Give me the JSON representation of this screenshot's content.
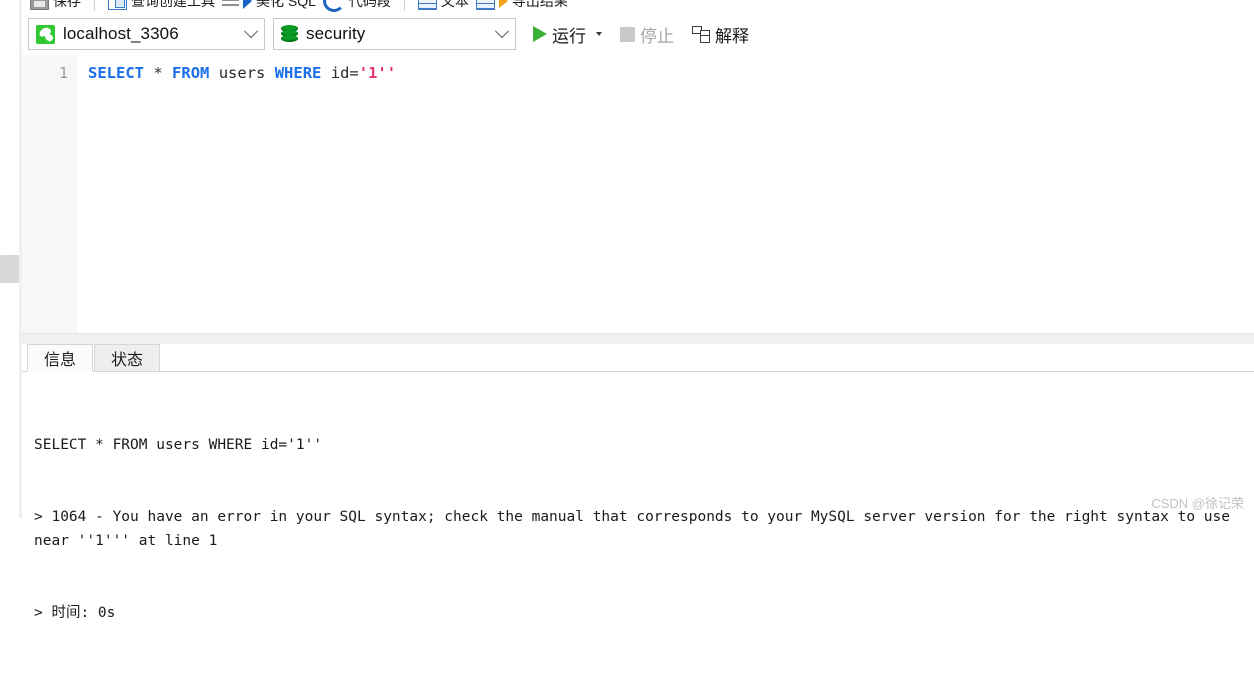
{
  "toolbar_top": {
    "items": [
      {
        "label": "保存",
        "icon": "save-icon"
      },
      {
        "label": "查询创建工具",
        "icon": "query-builder-icon"
      },
      {
        "label": "美化 SQL",
        "icon": "beautify-sql-icon"
      },
      {
        "label": "代码段",
        "icon": "code-snippet-icon"
      },
      {
        "label": "文本",
        "icon": "text-icon"
      },
      {
        "label": "导出结果",
        "icon": "export-result-icon"
      }
    ]
  },
  "toolbar": {
    "connection": {
      "value": "localhost_3306",
      "icon": "mysql-connection-icon"
    },
    "database": {
      "value": "security",
      "icon": "database-icon"
    },
    "run_label": "运行",
    "stop_label": "停止",
    "explain_label": "解释"
  },
  "editor": {
    "line_numbers": [
      "1"
    ],
    "tokens": [
      {
        "text": "SELECT",
        "type": "keyword"
      },
      {
        "text": " ",
        "type": "plain"
      },
      {
        "text": "*",
        "type": "operator"
      },
      {
        "text": " ",
        "type": "plain"
      },
      {
        "text": "FROM",
        "type": "keyword"
      },
      {
        "text": " ",
        "type": "plain"
      },
      {
        "text": "users",
        "type": "identifier"
      },
      {
        "text": " ",
        "type": "plain"
      },
      {
        "text": "WHERE",
        "type": "keyword"
      },
      {
        "text": " ",
        "type": "plain"
      },
      {
        "text": "id=",
        "type": "identifier"
      },
      {
        "text": "'1''",
        "type": "string"
      }
    ],
    "plain_text": "SELECT * FROM users WHERE id='1''"
  },
  "results": {
    "tabs": [
      {
        "label": "信息",
        "active": true
      },
      {
        "label": "状态",
        "active": false
      }
    ],
    "log_lines": [
      "SELECT * FROM users WHERE id='1''",
      "> 1064 - You have an error in your SQL syntax; check the manual that corresponds to your MySQL server version for the right syntax to use near ''1''' at line 1",
      "> 时间: 0s"
    ]
  },
  "watermark": "CSDN @徐记荣",
  "colors": {
    "keyword": "#1a6fec",
    "string": "#e8336d",
    "run_green": "#3cb034",
    "db_green": "#0a9c27",
    "conn_green": "#32c832"
  }
}
